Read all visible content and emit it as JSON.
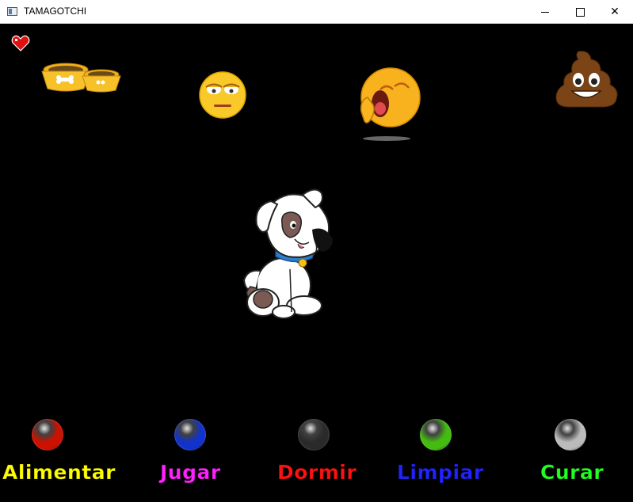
{
  "window": {
    "title": "TAMAGOTCHI",
    "icons": [
      "app-icon",
      "minimize-icon",
      "maximize-icon",
      "close-icon"
    ]
  },
  "status": {
    "icons": [
      "heart-icon",
      "food-bowl-icon",
      "bored-face-icon",
      "yawning-face-icon",
      "poop-icon"
    ]
  },
  "pet": {
    "icon": "dog-icon"
  },
  "actions": [
    {
      "label": "Alimentar",
      "color": "#ffff00",
      "button_color": "#cc1100",
      "icon": "red-orb-icon"
    },
    {
      "label": "Jugar",
      "color": "#ff22ff",
      "button_color": "#1133cc",
      "icon": "blue-orb-icon"
    },
    {
      "label": "Dormir",
      "color": "#ff1111",
      "button_color": "#2a2a2a",
      "icon": "black-orb-icon"
    },
    {
      "label": "Limpiar",
      "color": "#2222ff",
      "button_color": "#44bb11",
      "icon": "green-orb-icon"
    },
    {
      "label": "Curar",
      "color": "#22ff22",
      "button_color": "#bbbbbb",
      "icon": "silver-orb-icon"
    }
  ]
}
